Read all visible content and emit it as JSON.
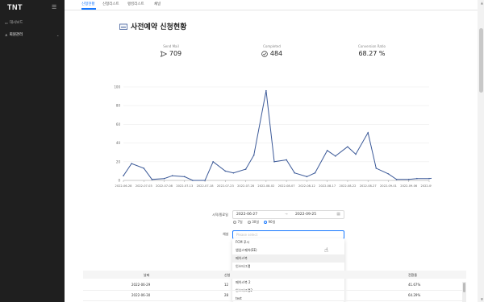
{
  "sidebar": {
    "brand": "TNT",
    "items": [
      {
        "label": "대시보드"
      },
      {
        "label": "회원관리"
      }
    ]
  },
  "tabs": [
    "신청현황",
    "신청리스트",
    "랭킹리스트",
    "채널"
  ],
  "page": {
    "title": "사전예약 신청현황"
  },
  "stats": [
    {
      "label": "Send Mail",
      "value": "709",
      "icon": "send-icon"
    },
    {
      "label": "Completed",
      "value": "484",
      "icon": "check-circle-icon"
    },
    {
      "label": "Conversion Ratio",
      "value": "68.27 %"
    }
  ],
  "chart_data": {
    "type": "line",
    "yticks": [
      "0",
      "20",
      "40",
      "60",
      "80",
      "100"
    ],
    "ylim": [
      0,
      100
    ],
    "xticks": [
      "2022-06-28",
      "2022-07-03",
      "2022-07-08",
      "2022-07-13",
      "2022-07-18",
      "2022-07-23",
      "2022-07-28",
      "2022-08-02",
      "2022-08-07",
      "2022-08-12",
      "2022-08-17",
      "2022-08-22",
      "2022-08-27",
      "2022-09-01",
      "2022-09-06",
      "2022-09-11"
    ],
    "x": [
      "2022-06-28",
      "2022-06-30",
      "2022-07-03",
      "2022-07-05",
      "2022-07-08",
      "2022-07-10",
      "2022-07-13",
      "2022-07-15",
      "2022-07-18",
      "2022-07-20",
      "2022-07-23",
      "2022-07-25",
      "2022-07-28",
      "2022-07-30",
      "2022-08-02",
      "2022-08-04",
      "2022-08-07",
      "2022-08-09",
      "2022-08-12",
      "2022-08-14",
      "2022-08-17",
      "2022-08-19",
      "2022-08-22",
      "2022-08-24",
      "2022-08-27",
      "2022-08-29",
      "2022-09-01",
      "2022-09-03",
      "2022-09-06",
      "2022-09-08",
      "2022-09-11",
      "2022-09-13",
      "2022-09-16",
      "2022-09-18",
      "2022-09-21",
      "2022-09-23",
      "2022-09-25"
    ],
    "values": [
      5,
      18,
      13,
      1,
      2,
      5,
      4,
      0,
      0,
      20,
      10,
      8,
      12,
      27,
      96,
      20,
      22,
      8,
      4,
      8,
      32,
      26,
      36,
      28,
      51,
      13,
      7,
      1,
      1,
      2,
      2,
      3,
      3,
      2,
      1,
      2,
      1
    ],
    "series_color": "#3b5998"
  },
  "form": {
    "date_label": "시작/종료일",
    "date_start": "2022-06-27",
    "date_sep": "→",
    "date_end": "2022-09-25",
    "ranges": [
      "7일",
      "30일",
      "90일"
    ],
    "range_selected": "90일",
    "channel_label": "채널",
    "channel_placeholder": "Please select",
    "options": [
      "FCM 푸시",
      "앱업스퀘어(EE)",
      "페이스북",
      "인스타그램",
      "구글",
      "페이스북 2",
      "인스타그램2",
      "test"
    ]
  },
  "table": {
    "headers": [
      "날짜",
      "신청",
      "전환율"
    ],
    "rows": [
      {
        "date": "2022-06-29",
        "count": "12",
        "ratio": "41.67%"
      },
      {
        "date": "2022-06-30",
        "count": "28",
        "ratio": "64.29%"
      }
    ]
  }
}
